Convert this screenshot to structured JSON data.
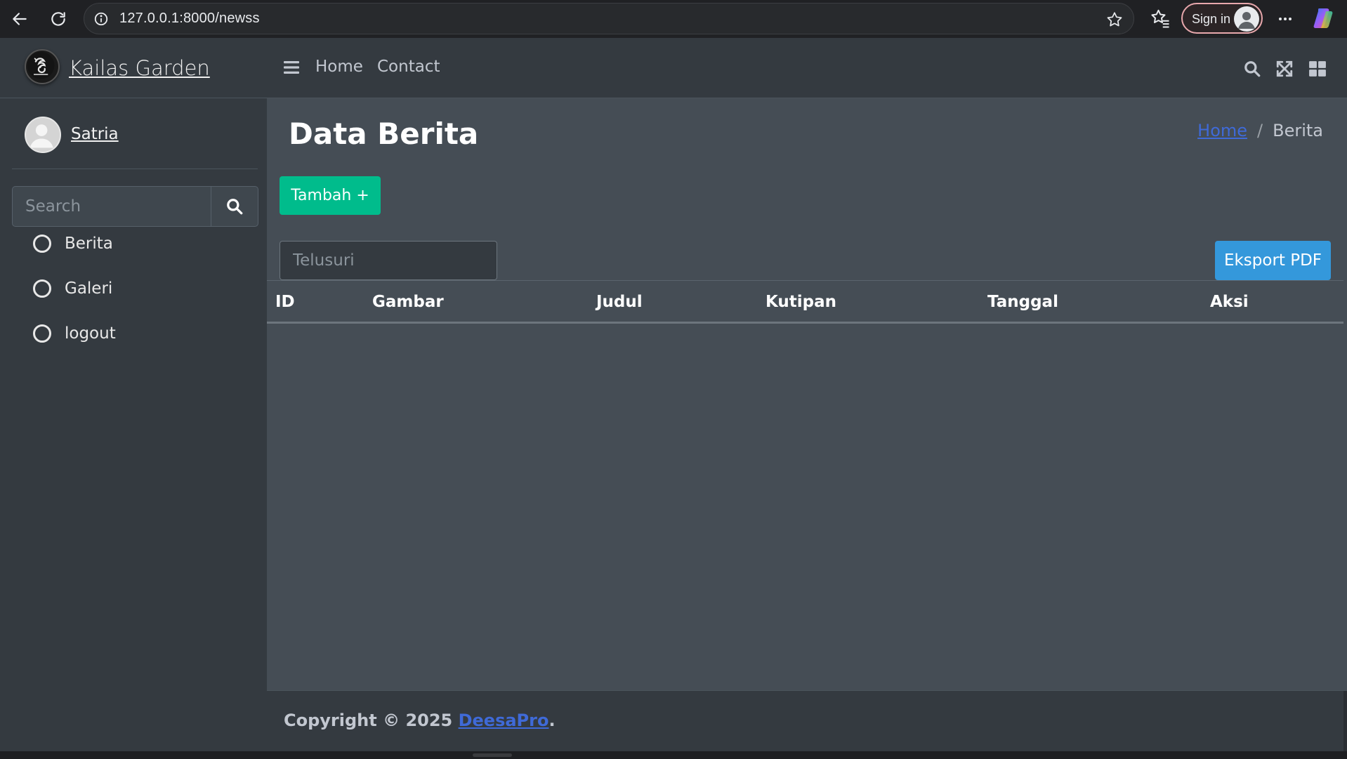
{
  "browser": {
    "url": "127.0.0.1:8000/newss",
    "signin_label": "Sign in"
  },
  "sidebar": {
    "brand": "Kailas Garden",
    "user_name": "Satria",
    "search_placeholder": "Search",
    "items": [
      {
        "label": "Berita"
      },
      {
        "label": "Galeri"
      },
      {
        "label": "logout"
      }
    ]
  },
  "topnav": {
    "links": [
      "Home",
      "Contact"
    ]
  },
  "content": {
    "title": "Data Berita",
    "breadcrumb": {
      "home": "Home",
      "current": "Berita",
      "separator": "/"
    },
    "add_button": "Tambah +",
    "table_search_placeholder": "Telusuri",
    "export_button": "Eksport PDF",
    "columns": [
      "ID",
      "Gambar",
      "Judul",
      "Kutipan",
      "Tanggal",
      "Aksi"
    ]
  },
  "footer": {
    "prefix": "Copyright © 2025 ",
    "brand": "DeesaPro",
    "suffix": "."
  },
  "colors": {
    "sidebar_bg": "#343a40",
    "content_bg": "#454d55",
    "success": "#00bc8c",
    "info": "#3498db",
    "link": "#3f6ad8"
  }
}
